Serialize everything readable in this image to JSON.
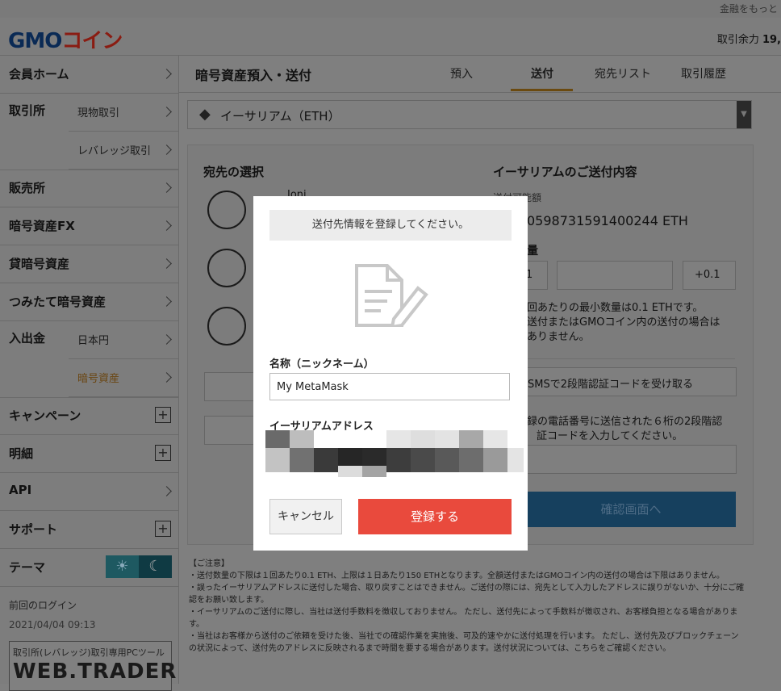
{
  "top_strip": {
    "link": "金融をもっと"
  },
  "header": {
    "logo_text": "GMOコイン",
    "balance_label": "取引余力",
    "balance_value": "19,"
  },
  "sidebar": {
    "member_home": "会員ホーム",
    "exchange": "取引所",
    "exchange_spot": "現物取引",
    "exchange_leverage": "レバレッジ取引",
    "sales": "販売所",
    "crypto_fx": "暗号資産FX",
    "lending": "貸暗号資産",
    "tsumitate": "つみたて暗号資産",
    "deposit_withdraw": "入出金",
    "jpy": "日本円",
    "crypto": "暗号資産",
    "campaign": "キャンペーン",
    "statement": "明細",
    "api": "API",
    "support": "サポート",
    "theme": "テーマ",
    "last_login_label": "前回のログイン",
    "last_login_value": "2021/04/04 09:13",
    "webtrader_small": "取引所(レバレッジ)取引専用PCツール",
    "webtrader_big": "WEB.TRADER"
  },
  "main": {
    "title": "暗号資産預入・送付",
    "tabs": [
      "預入",
      "送付",
      "宛先リスト",
      "取引履歴"
    ],
    "active_tab": "送付",
    "coin": "イーサリアム（ETH）",
    "dest_heading": "宛先の選択",
    "dest_name_partial": "Joni",
    "send_heading": "イーサリアムのご送付内容",
    "available_label": "送付可能額",
    "available_value": "0598731591400244 ETH",
    "qty_label": "量",
    "minus_partial": "1",
    "plus_label": "+0.1",
    "min_note_1": "回あたりの最小数量は0.1 ETHです。",
    "min_note_2": "送付またはGMOコイン内の送付の場合は",
    "min_note_3": "ありません。",
    "sms_button": "SMSで2段階認証コードを受け取る",
    "sms_note_1": "録の電話番号に送信された６桁の2段階認",
    "sms_note_2": "証コードを入力してください。",
    "confirm_button": "確認画面へ",
    "notes": [
      "【ご注意】",
      "・送付数量の下限は１回あたり0.1 ETH、上限は１日あたり150 ETHとなります。全額送付またはGMOコイン内の送付の場合は下限はありません。",
      "・誤ったイーサリアムアドレスに送付した場合、取り戻すことはできません。ご送付の際には、宛先として入力したアドレスに誤りがないか、十分にご確",
      "認をお願い致します。",
      "・イーサリアムのご送付に際し、当社は送付手数料を徴収しておりません。 ただし、送付先によって手数料が徴収され、お客様負担となる場合がありま",
      "す。",
      "・当社はお客様から送付のご依頼を受けた後、当社での確認作業を実施後、可及的速やかに送付処理を行います。 ただし、送付先及びブロックチェーン",
      "の状況によって、送付先のアドレスに反映されるまで時間を要する場合があります。送付状況については、こちらをご確認ください。"
    ]
  },
  "modal": {
    "banner": "送付先情報を登録してください。",
    "name_label": "名称（ニックネーム）",
    "name_value": "My MetaMask",
    "address_label": "イーサリアムアドレス",
    "cancel_button": "キャンセル",
    "register_button": "登録する"
  },
  "colors": {
    "overlay": "#7f7f7f",
    "register": "#e94a3d",
    "tab_active": "#6b4a10"
  }
}
